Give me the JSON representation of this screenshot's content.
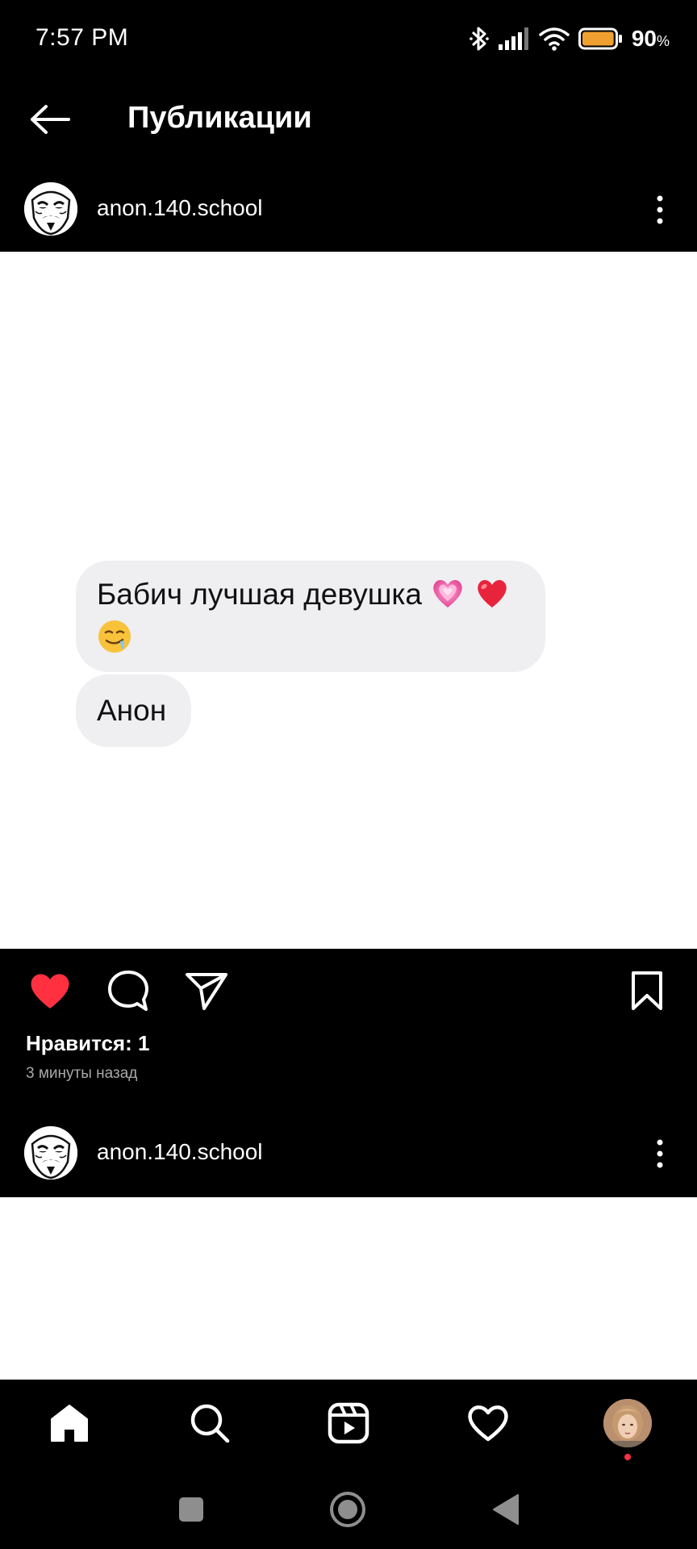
{
  "status_bar": {
    "time": "7:57 PM",
    "battery_percent": "90",
    "battery_unit": "%",
    "battery_level": 0.9,
    "icons": [
      "bluetooth-icon",
      "signal-icon",
      "wifi-icon",
      "battery-icon"
    ]
  },
  "header": {
    "title": "Публикации",
    "back_icon": "arrow-left-icon"
  },
  "posts": [
    {
      "username": "anon.140.school",
      "image": {
        "messages": [
          {
            "text": "Бабич лучшая девушка",
            "emojis": [
              "growing-heart",
              "red-heart",
              "drooling-face"
            ]
          },
          {
            "text": "Анон"
          }
        ]
      },
      "liked": true,
      "likes_text": "Нравится: 1",
      "time_ago": "3 минуты назад"
    },
    {
      "username": "anon.140.school"
    }
  ],
  "bottom_nav": {
    "items": [
      "home-icon",
      "search-icon",
      "reels-icon",
      "heart-icon",
      "profile-avatar"
    ],
    "notification_dot": true
  },
  "colors": {
    "background": "#000000",
    "like_red": "#ff3040",
    "bubble": "#efeef1",
    "battery": "#f0a030"
  }
}
